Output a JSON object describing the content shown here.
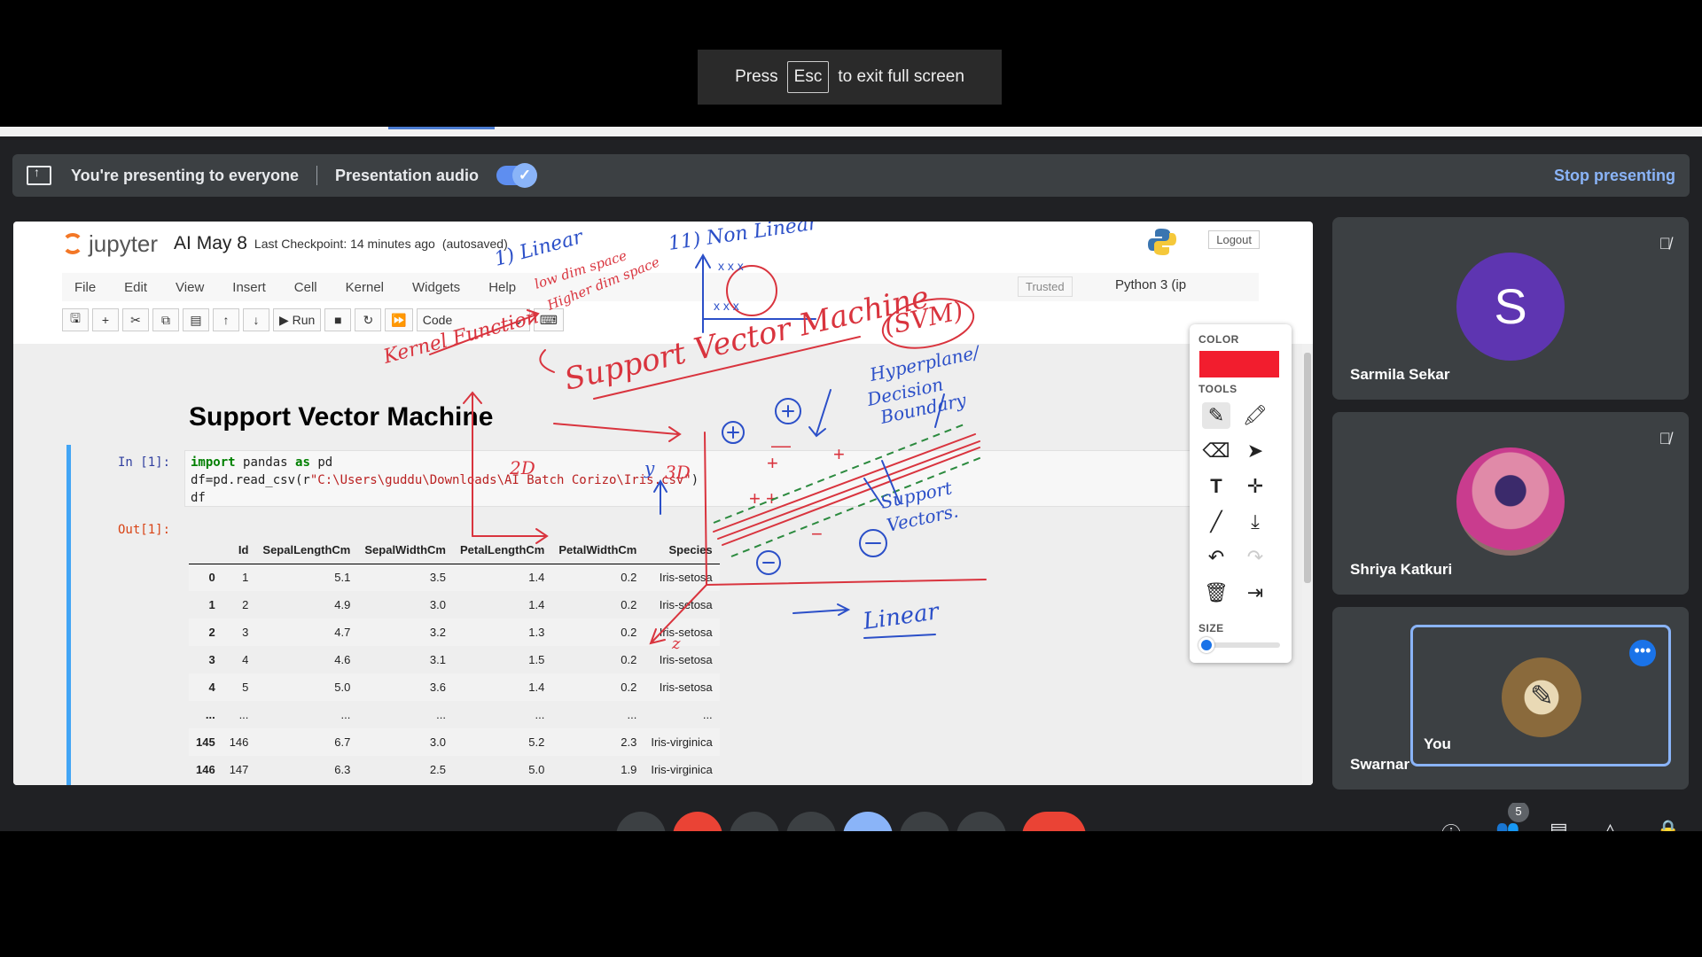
{
  "fullscreen_toast": {
    "press": "Press",
    "key": "Esc",
    "rest": "to exit full screen"
  },
  "presenting_bar": {
    "status": "You're presenting to everyone",
    "audio_label": "Presentation audio",
    "audio_enabled": true,
    "stop_label": "Stop presenting"
  },
  "jupyter": {
    "logo_text": "jupyter",
    "notebook_title": "AI May 8",
    "checkpoint": "Last Checkpoint: 14 minutes ago",
    "autosaved": "(autosaved)",
    "logout": "Logout",
    "menu": [
      "File",
      "Edit",
      "View",
      "Insert",
      "Cell",
      "Kernel",
      "Widgets",
      "Help"
    ],
    "trusted": "Trusted",
    "kernel": "Python 3 (ip",
    "run_label": "Run",
    "cell_type": "Code",
    "heading": "Support Vector Machine",
    "in_prompt": "In [1]:",
    "out_prompt": "Out[1]:",
    "code": {
      "line1_kw": "import",
      "line1_mod": "pandas",
      "line1_as": "as",
      "line1_alias": "pd",
      "line2_pre": "df=pd.read_csv(r",
      "line2_str": "\"C:\\Users\\guddu\\Downloads\\AI Batch Corizo\\Iris.csv\"",
      "line2_post": ")",
      "line3": "df"
    },
    "table": {
      "columns": [
        "",
        "Id",
        "SepalLengthCm",
        "SepalWidthCm",
        "PetalLengthCm",
        "PetalWidthCm",
        "Species"
      ],
      "rows": [
        [
          "0",
          "1",
          "5.1",
          "3.5",
          "1.4",
          "0.2",
          "Iris-setosa"
        ],
        [
          "1",
          "2",
          "4.9",
          "3.0",
          "1.4",
          "0.2",
          "Iris-setosa"
        ],
        [
          "2",
          "3",
          "4.7",
          "3.2",
          "1.3",
          "0.2",
          "Iris-setosa"
        ],
        [
          "3",
          "4",
          "4.6",
          "3.1",
          "1.5",
          "0.2",
          "Iris-setosa"
        ],
        [
          "4",
          "5",
          "5.0",
          "3.6",
          "1.4",
          "0.2",
          "Iris-setosa"
        ],
        [
          "...",
          "...",
          "...",
          "...",
          "...",
          "...",
          "..."
        ],
        [
          "145",
          "146",
          "6.7",
          "3.0",
          "5.2",
          "2.3",
          "Iris-virginica"
        ],
        [
          "146",
          "147",
          "6.3",
          "2.5",
          "5.0",
          "1.9",
          "Iris-virginica"
        ]
      ]
    }
  },
  "annotations": {
    "ink_color": "#d9343e",
    "blue_ink": "#2b4fc8",
    "texts": {
      "linear_1": "1) Linear",
      "low_dim": "low dim space",
      "higher_dim": "Higher dim space",
      "kernel_fn": "Kernel Function",
      "non_linear": "11) Non Linear",
      "svm_title": "Support Vector Machine",
      "svm_abbr": "(SVM)",
      "hyperplane": "Hyperplane/",
      "decision": "Decision",
      "boundary": "Boundary",
      "support_vectors_1": "Support",
      "support_vectors_2": "Vectors.",
      "three_d": "3D",
      "two_d": "2D",
      "y_axis": "y",
      "z_axis": "z",
      "linear_bottom": "Linear"
    }
  },
  "palette": {
    "color_label": "COLOR",
    "current_color": "#f21d2e",
    "tools_label": "TOOLS",
    "size_label": "SIZE",
    "size_value": 0.0,
    "tools": [
      "pen-icon",
      "highlighter-icon",
      "eraser-icon",
      "pointer-icon",
      "text-icon",
      "move-icon",
      "line-icon",
      "download-icon",
      "undo-icon",
      "redo-icon",
      "trash-icon",
      "exit-icon"
    ]
  },
  "participants": [
    {
      "name": "Sarmila Sekar",
      "initial": "S",
      "muted": true
    },
    {
      "name": "Shriya Katkuri",
      "muted": true
    },
    {
      "name": "Swarnar",
      "self_label": "You"
    }
  ],
  "meeting": {
    "participant_count": "5"
  }
}
